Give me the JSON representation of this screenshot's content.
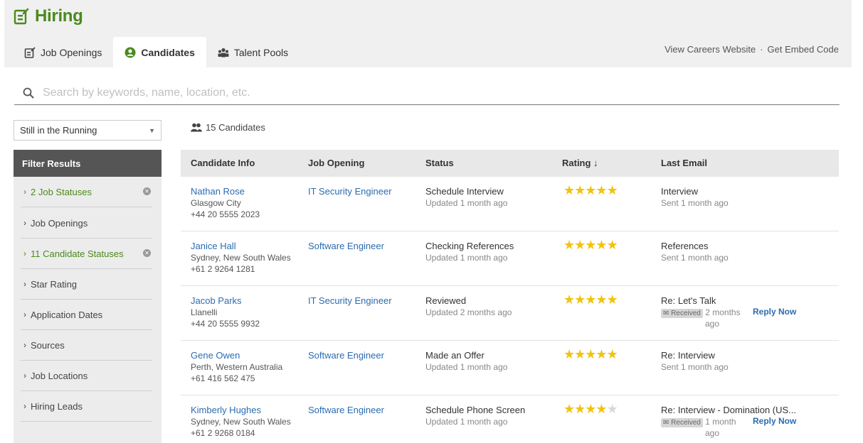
{
  "app": {
    "title": "Hiring",
    "accent": "#4a8a1c"
  },
  "tabs": [
    {
      "label": "Job Openings",
      "icon": "job-openings-icon",
      "active": false
    },
    {
      "label": "Candidates",
      "icon": "candidates-icon",
      "active": true
    },
    {
      "label": "Talent Pools",
      "icon": "talent-pools-icon",
      "active": false
    }
  ],
  "header_links": {
    "careers": "View Careers Website",
    "separator": "·",
    "embed": "Get Embed Code"
  },
  "search": {
    "placeholder": "Search by keywords, name, location, etc.",
    "value": ""
  },
  "sidebar": {
    "select_value": "Still in the Running",
    "filter_title": "Filter Results",
    "filters": [
      {
        "label": "2 Job Statuses",
        "active": true
      },
      {
        "label": "Job Openings",
        "active": false
      },
      {
        "label": "11 Candidate Statuses",
        "active": true
      },
      {
        "label": "Star Rating",
        "active": false
      },
      {
        "label": "Application Dates",
        "active": false
      },
      {
        "label": "Sources",
        "active": false
      },
      {
        "label": "Job Locations",
        "active": false
      },
      {
        "label": "Hiring Leads",
        "active": false
      }
    ]
  },
  "table": {
    "count": "15 Candidates",
    "headers": [
      "Candidate Info",
      "Job Opening",
      "Status",
      "Rating ↓",
      "Last Email"
    ],
    "rows": [
      {
        "name": "Nathan Rose",
        "location": "Glasgow City",
        "phone": "+44 20 5555 2023",
        "job": "IT Security Engineer",
        "status": "Schedule Interview",
        "status_time": "Updated 1 month ago",
        "rating": 5,
        "email_subject": "Interview",
        "email_meta": "Sent 1 month ago",
        "received": false
      },
      {
        "name": "Janice Hall",
        "location": "Sydney, New South Wales",
        "phone": "+61 2 9264 1281",
        "job": "Software Engineer",
        "status": "Checking References",
        "status_time": "Updated 1 month ago",
        "rating": 5,
        "email_subject": "References",
        "email_meta": "Sent 1 month ago",
        "received": false
      },
      {
        "name": "Jacob Parks",
        "location": "Llanelli",
        "phone": "+44 20 5555 9932",
        "job": "IT Security Engineer",
        "status": "Reviewed",
        "status_time": "Updated 2 months ago",
        "rating": 5,
        "email_subject": "Re: Let's Talk",
        "email_badge": "Received",
        "email_meta_a": "2 months",
        "email_meta_b": "ago",
        "reply": "Reply Now",
        "received": true
      },
      {
        "name": "Gene Owen",
        "location": "Perth, Western Australia",
        "phone": "+61 416 562 475",
        "job": "Software Engineer",
        "status": "Made an Offer",
        "status_time": "Updated 1 month ago",
        "rating": 5,
        "email_subject": "Re: Interview",
        "email_meta": "Sent 1 month ago",
        "received": false
      },
      {
        "name": "Kimberly Hughes",
        "location": "Sydney, New South Wales",
        "phone": "+61 2 9268 0184",
        "job": "Software Engineer",
        "status": "Schedule Phone Screen",
        "status_time": "Updated 1 month ago",
        "rating": 4,
        "email_subject": "Re: Interview - Domination (US...",
        "email_badge": "Received",
        "email_meta_a": "1 month",
        "email_meta_b": "ago",
        "reply": "Reply Now",
        "received": true
      }
    ]
  }
}
